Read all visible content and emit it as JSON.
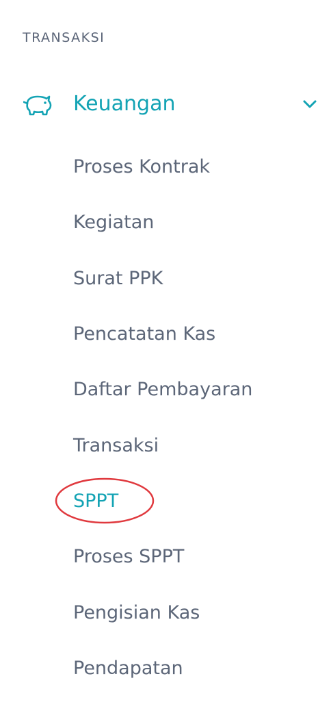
{
  "section": {
    "title": "TRANSAKSI"
  },
  "group": {
    "label": "Keuangan",
    "icon": "piggy-bank-icon",
    "expanded": true
  },
  "submenu": [
    {
      "label": "Proses Kontrak"
    },
    {
      "label": "Kegiatan"
    },
    {
      "label": "Surat PPK"
    },
    {
      "label": "Pencatatan Kas"
    },
    {
      "label": "Daftar Pembayaran"
    },
    {
      "label": "Transaksi"
    },
    {
      "label": "SPPT",
      "active": true
    },
    {
      "label": "Proses SPPT"
    },
    {
      "label": "Pengisian Kas"
    },
    {
      "label": "Pendapatan"
    }
  ],
  "colors": {
    "accent": "#13a3b4",
    "text": "#5c6678",
    "highlight": "#e0393e"
  }
}
